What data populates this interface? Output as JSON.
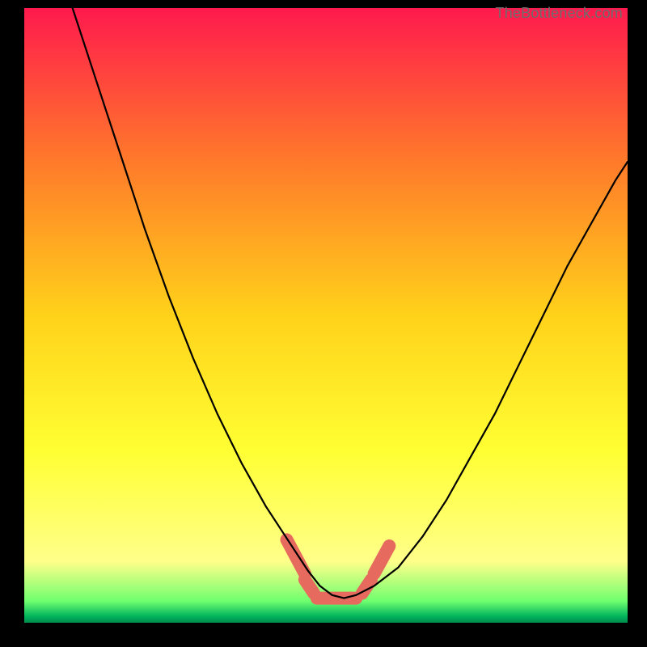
{
  "watermark": "TheBottleneck.com",
  "chart_data": {
    "type": "line",
    "title": "",
    "xlabel": "",
    "ylabel": "",
    "xlim": [
      0,
      100
    ],
    "ylim": [
      0,
      100
    ],
    "grid": false,
    "legend": false,
    "background_gradient": {
      "stops": [
        {
          "offset": 0.0,
          "color": "#ff1a4d"
        },
        {
          "offset": 0.25,
          "color": "#ff7a2a"
        },
        {
          "offset": 0.5,
          "color": "#ffd21a"
        },
        {
          "offset": 0.72,
          "color": "#ffff33"
        },
        {
          "offset": 0.9,
          "color": "#ffff8a"
        },
        {
          "offset": 0.965,
          "color": "#6fff6f"
        },
        {
          "offset": 0.99,
          "color": "#00b35c"
        },
        {
          "offset": 1.0,
          "color": "#008b4b"
        }
      ]
    },
    "series": [
      {
        "name": "bottleneck-curve",
        "color": "#000000",
        "x": [
          8,
          12,
          16,
          20,
          24,
          28,
          32,
          36,
          40,
          44,
          47,
          49,
          51,
          53,
          55,
          58,
          62,
          66,
          70,
          74,
          78,
          82,
          86,
          90,
          94,
          98,
          100
        ],
        "y": [
          100,
          88,
          76,
          64,
          53,
          43,
          34,
          26,
          19,
          13,
          8.5,
          6,
          4.5,
          4,
          4.5,
          6,
          9,
          14,
          20,
          27,
          34,
          42,
          50,
          58,
          65,
          72,
          75
        ]
      }
    ],
    "marker_band": {
      "color": "#e66a5e",
      "segments": [
        {
          "x1": 43.5,
          "y1": 13.5,
          "x2": 46.5,
          "y2": 8.0
        },
        {
          "x1": 46.5,
          "y1": 7.0,
          "x2": 48.0,
          "y2": 4.8
        },
        {
          "x1": 48.5,
          "y1": 4.0,
          "x2": 55.0,
          "y2": 4.0
        },
        {
          "x1": 56.0,
          "y1": 4.8,
          "x2": 57.5,
          "y2": 7.0
        },
        {
          "x1": 58.0,
          "y1": 8.0,
          "x2": 60.5,
          "y2": 12.5
        }
      ],
      "stroke_width": 16
    }
  }
}
